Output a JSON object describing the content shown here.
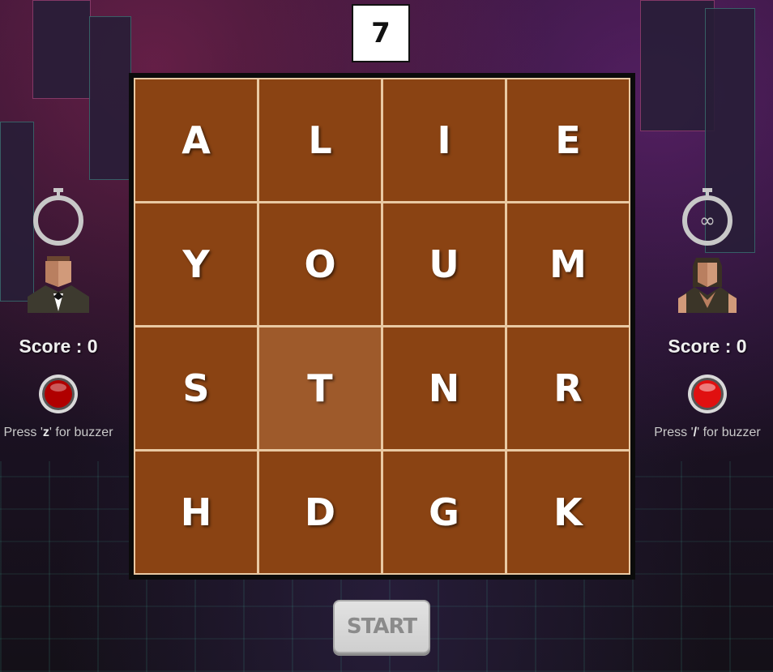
{
  "round_timer": "7",
  "board": {
    "rows": [
      [
        "A",
        "L",
        "I",
        "E"
      ],
      [
        "Y",
        "O",
        "U",
        "M"
      ],
      [
        "S",
        "T",
        "N",
        "R"
      ],
      [
        "H",
        "D",
        "G",
        "K"
      ]
    ],
    "highlighted": "T"
  },
  "player1": {
    "timer_icon": "stopwatch-icon",
    "avatar_icon": "man-avatar-icon",
    "score_label": "Score : 0",
    "buzzer_color": "#b00000",
    "hint_prefix": "Press '",
    "hint_key": "z",
    "hint_suffix": "' for buzzer"
  },
  "player2": {
    "timer_icon": "stopwatch-icon",
    "timer_symbol": "∞",
    "avatar_icon": "woman-avatar-icon",
    "score_label": "Score : 0",
    "buzzer_color": "#e01010",
    "hint_prefix": "Press '",
    "hint_key": "/",
    "hint_suffix": "' for buzzer"
  },
  "start_label": "START",
  "colors": {
    "tile": "#8a4313",
    "tile_highlight": "#9e5a2b",
    "board_frame": "#0b0b0b"
  }
}
